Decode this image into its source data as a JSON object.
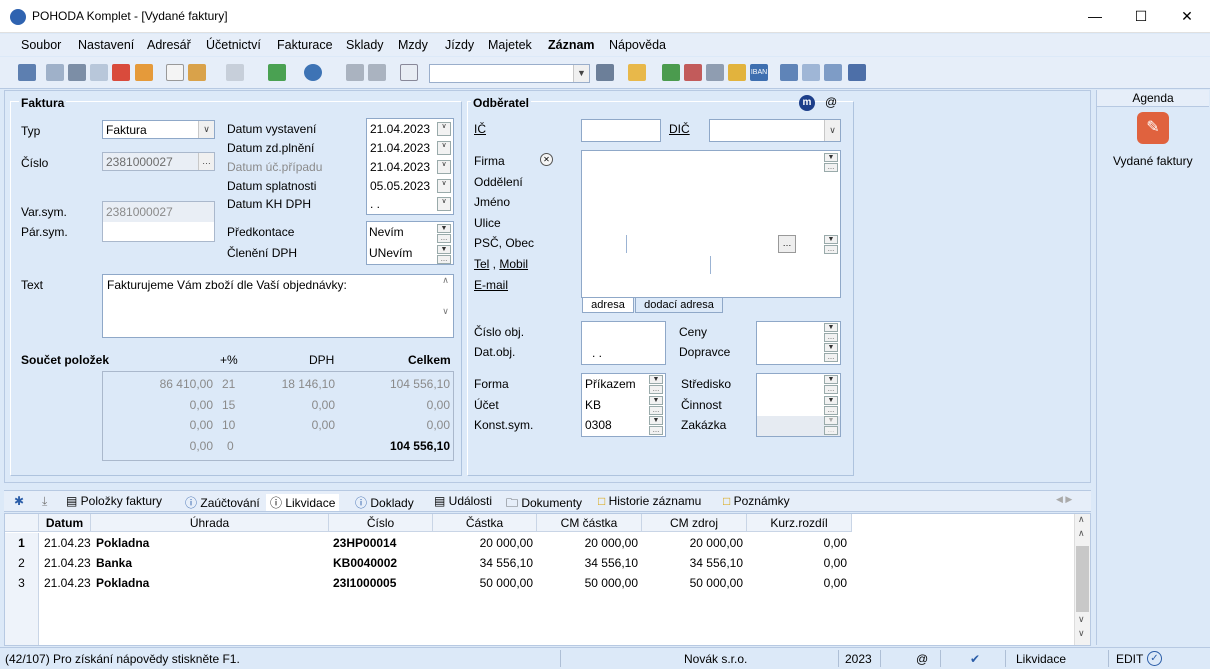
{
  "window": {
    "title": "POHODA Komplet - [Vydané faktury]"
  },
  "menu": [
    "Soubor",
    "Nastavení",
    "Adresář",
    "Účetnictví",
    "Fakturace",
    "Sklady",
    "Mzdy",
    "Jízdy",
    "Majetek",
    "Záznam",
    "Nápověda"
  ],
  "faktura": {
    "section": "Faktura",
    "typ_label": "Typ",
    "typ_value": "Faktura",
    "cislo_label": "Číslo",
    "cislo_value": "2381000027",
    "varsym_label": "Var.sym.",
    "varsym_value": "2381000027",
    "parsym_label": "Pár.sym.",
    "dates": [
      {
        "label": "Datum vystavení",
        "value": "21.04.2023"
      },
      {
        "label": "Datum zd.plnění",
        "value": "21.04.2023"
      },
      {
        "label": "Datum úč.případu",
        "value": "21.04.2023"
      },
      {
        "label": "Datum splatnosti",
        "value": "05.05.2023"
      },
      {
        "label": "Datum KH DPH",
        "value": " .  ."
      }
    ],
    "predkontace_label": "Předkontace",
    "predkontace_value": "Nevím",
    "cleneni_label": "Členění DPH",
    "cleneni_value": "UNevím",
    "text_label": "Text",
    "text_value": "Fakturujeme Vám zboží dle Vaší objednávky:"
  },
  "soucet": {
    "title": "Součet položek",
    "col_pct": "+%",
    "col_dph": "DPH",
    "col_celkem": "Celkem",
    "rows": [
      {
        "base": "86 410,00",
        "pct": "21",
        "dph": "18 146,10",
        "total": "104 556,10"
      },
      {
        "base": "0,00",
        "pct": "15",
        "dph": "0,00",
        "total": "0,00"
      },
      {
        "base": "0,00",
        "pct": "10",
        "dph": "0,00",
        "total": "0,00"
      },
      {
        "base": "0,00",
        "pct": "0",
        "dph": "",
        "total": "104 556,10"
      }
    ]
  },
  "odberatel": {
    "section": "Odběratel",
    "ic_label": "IČ",
    "dic_label": "DIČ",
    "labels": [
      "Firma",
      "Oddělení",
      "Jméno",
      "Ulice",
      "PSČ, Obec"
    ],
    "tel_label": "Tel",
    "mobil_label": "Mobil",
    "email_label": "E-mail",
    "addr_tab1": "adresa",
    "addr_tab2": "dodací adresa",
    "cisloobj_label": "Číslo obj.",
    "datobj_label": "Dat.obj.",
    "datobj_value": ".  .",
    "ceny_label": "Ceny",
    "dopravce_label": "Dopravce",
    "forma_label": "Forma",
    "forma_value": "Příkazem",
    "ucet_label": "Účet",
    "ucet_value": "KB",
    "konst_label": "Konst.sym.",
    "konst_value": "0308",
    "stredisko_label": "Středisko",
    "cinnost_label": "Činnost",
    "zakazka_label": "Zakázka"
  },
  "agenda": {
    "header": "Agenda",
    "item": "Vydané faktury"
  },
  "tabs": [
    "Položky faktury",
    "Zaúčtování",
    "Likvidace",
    "Doklady",
    "Události",
    "Dokumenty",
    "Historie záznamu",
    "Poznámky"
  ],
  "grid": {
    "headers": [
      "Datum",
      "Úhrada",
      "Číslo",
      "Částka",
      "CM částka",
      "CM zdroj",
      "Kurz.rozdíl"
    ],
    "rows": [
      {
        "n": "1",
        "datum": "21.04.23",
        "uhrada": "Pokladna",
        "cislo": "23HP00014",
        "castka": "20 000,00",
        "cm": "20 000,00",
        "zdroj": "20 000,00",
        "kurz": "0,00"
      },
      {
        "n": "2",
        "datum": "21.04.23",
        "uhrada": "Banka",
        "cislo": "KB0040002",
        "castka": "34 556,10",
        "cm": "34 556,10",
        "zdroj": "34 556,10",
        "kurz": "0,00"
      },
      {
        "n": "3",
        "datum": "21.04.23",
        "uhrada": "Pokladna",
        "cislo": "23I1000005",
        "castka": "50 000,00",
        "cm": "50 000,00",
        "zdroj": "50 000,00",
        "kurz": "0,00"
      }
    ]
  },
  "status": {
    "left": "(42/107) Pro získání nápovědy stiskněte F1.",
    "company": "Novák s.r.o.",
    "year": "2023",
    "at": "@",
    "agenda": "Likvidace",
    "mode": "EDIT"
  }
}
